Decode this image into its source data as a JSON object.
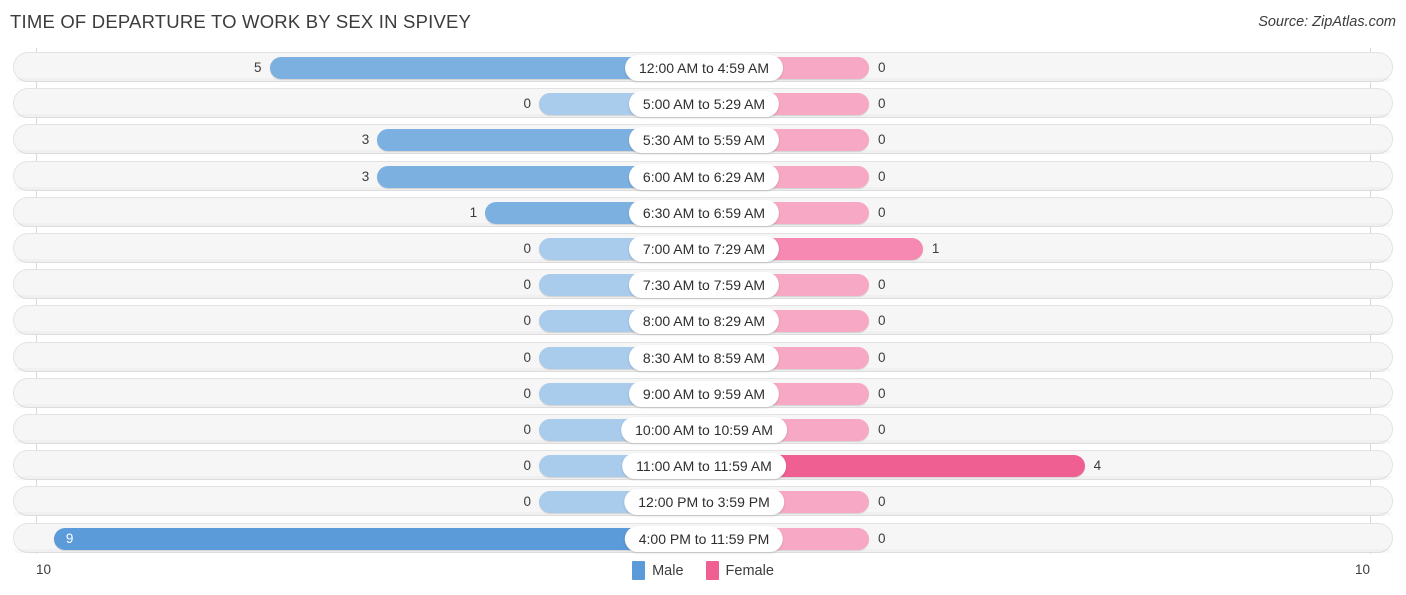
{
  "header": {
    "title": "TIME OF DEPARTURE TO WORK BY SEX IN SPIVEY",
    "source": "Source: ZipAtlas.com"
  },
  "footer": {
    "axis_left": "10",
    "axis_right": "10",
    "legend": [
      {
        "label": "Male",
        "color": "#5b9bd9"
      },
      {
        "label": "Female",
        "color": "#ef5f92"
      }
    ]
  },
  "colors": {
    "male_strong": "#5b9bd9",
    "male_mid": "#7cb0e0",
    "male_light": "#a9cbec",
    "female_strong": "#ef5f92",
    "female_mid": "#f589b1",
    "female_light": "#f7a8c4",
    "row_bg": "#f6f6f6",
    "row_border": "#e3e3e3",
    "text": "#3c3c3c"
  },
  "chart_data": {
    "type": "bar",
    "title": "TIME OF DEPARTURE TO WORK BY SEX IN SPIVEY",
    "subtitle": "Source: ZipAtlas.com",
    "orientation": "horizontal",
    "layout": "diverging-bidirectional",
    "xlabel": "",
    "ylabel": "",
    "axis_max_left": 10,
    "axis_max_right": 10,
    "grid": false,
    "legend_position": "bottom-center",
    "categories": [
      "12:00 AM to 4:59 AM",
      "5:00 AM to 5:29 AM",
      "5:30 AM to 5:59 AM",
      "6:00 AM to 6:29 AM",
      "6:30 AM to 6:59 AM",
      "7:00 AM to 7:29 AM",
      "7:30 AM to 7:59 AM",
      "8:00 AM to 8:29 AM",
      "8:30 AM to 8:59 AM",
      "9:00 AM to 9:59 AM",
      "10:00 AM to 10:59 AM",
      "11:00 AM to 11:59 AM",
      "12:00 PM to 3:59 PM",
      "4:00 PM to 11:59 PM"
    ],
    "series": [
      {
        "name": "Male",
        "side": "left",
        "color": "#5b9bd9",
        "values": [
          5,
          0,
          3,
          3,
          1,
          0,
          0,
          0,
          0,
          0,
          0,
          0,
          0,
          9
        ]
      },
      {
        "name": "Female",
        "side": "right",
        "color": "#ef5f92",
        "values": [
          0,
          0,
          0,
          0,
          0,
          1,
          0,
          0,
          0,
          0,
          0,
          4,
          0,
          0
        ]
      }
    ]
  },
  "rows": [
    {
      "label": "12:00 AM to 4:59 AM",
      "male": "5",
      "female": "0"
    },
    {
      "label": "5:00 AM to 5:29 AM",
      "male": "0",
      "female": "0"
    },
    {
      "label": "5:30 AM to 5:59 AM",
      "male": "3",
      "female": "0"
    },
    {
      "label": "6:00 AM to 6:29 AM",
      "male": "3",
      "female": "0"
    },
    {
      "label": "6:30 AM to 6:59 AM",
      "male": "1",
      "female": "0"
    },
    {
      "label": "7:00 AM to 7:29 AM",
      "male": "0",
      "female": "1"
    },
    {
      "label": "7:30 AM to 7:59 AM",
      "male": "0",
      "female": "0"
    },
    {
      "label": "8:00 AM to 8:29 AM",
      "male": "0",
      "female": "0"
    },
    {
      "label": "8:30 AM to 8:59 AM",
      "male": "0",
      "female": "0"
    },
    {
      "label": "9:00 AM to 9:59 AM",
      "male": "0",
      "female": "0"
    },
    {
      "label": "10:00 AM to 10:59 AM",
      "male": "0",
      "female": "0"
    },
    {
      "label": "11:00 AM to 11:59 AM",
      "male": "0",
      "female": "4"
    },
    {
      "label": "12:00 PM to 3:59 PM",
      "male": "0",
      "female": "0"
    },
    {
      "label": "4:00 PM to 11:59 PM",
      "male": "9",
      "female": "0"
    }
  ]
}
